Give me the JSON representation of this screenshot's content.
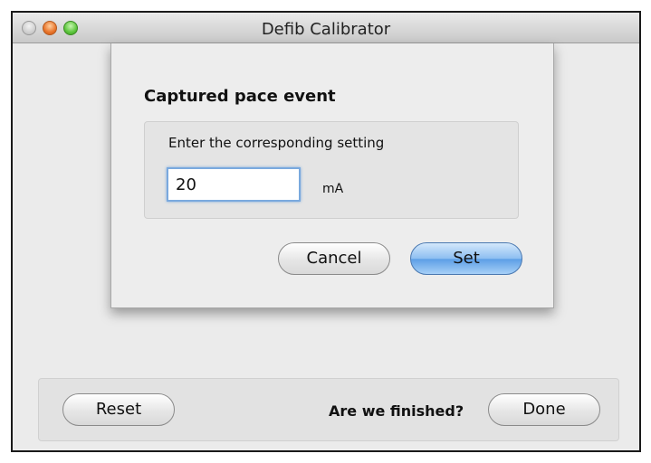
{
  "window": {
    "title": "Defib Calibrator"
  },
  "dialog": {
    "title": "Captured pace event",
    "prompt": "Enter the corresponding setting",
    "value": "20",
    "unit": "mA",
    "cancel_label": "Cancel",
    "set_label": "Set"
  },
  "footer": {
    "reset_label": "Reset",
    "question": "Are we finished?",
    "done_label": "Done"
  },
  "colors": {
    "default_button": "#8dbef1",
    "focus_ring": "#7aa9de"
  }
}
